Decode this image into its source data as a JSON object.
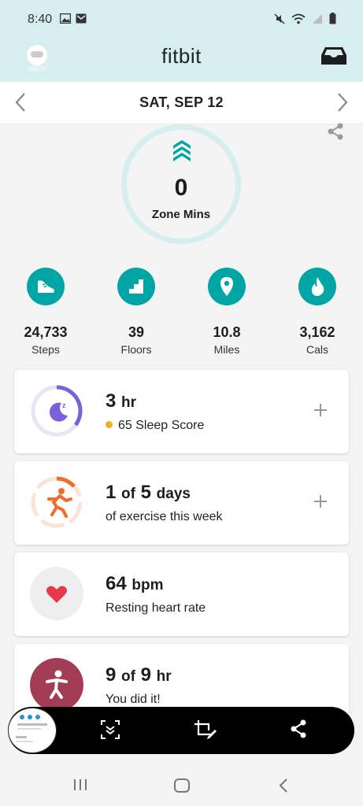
{
  "status": {
    "time": "8:40"
  },
  "header": {
    "title": "fitbit"
  },
  "date_nav": {
    "date": "SAT, SEP 12"
  },
  "zone": {
    "value": "0",
    "label": "Zone Mins"
  },
  "stats": [
    {
      "value": "24,733",
      "label": "Steps",
      "icon": "shoe-icon"
    },
    {
      "value": "39",
      "label": "Floors",
      "icon": "stairs-icon"
    },
    {
      "value": "10.8",
      "label": "Miles",
      "icon": "location-pin-icon"
    },
    {
      "value": "3,162",
      "label": "Cals",
      "icon": "flame-icon"
    }
  ],
  "cards": {
    "sleep": {
      "value": "3",
      "unit": "hr",
      "sub": "65 Sleep Score"
    },
    "exercise": {
      "value": "1",
      "of": "of",
      "total": "5",
      "unit": "days",
      "sub": "of exercise this week"
    },
    "heart": {
      "value": "64",
      "unit": "bpm",
      "sub": "Resting heart rate"
    },
    "hourly": {
      "value": "9",
      "of": "of",
      "total": "9",
      "unit": "hr",
      "sub": "You did it!"
    }
  },
  "colors": {
    "header_bg": "#d7eef0",
    "accent": "#00a5a5",
    "sleep": "#7b61d9",
    "exercise": "#f06c2b",
    "heart": "#e8394a",
    "hourly": "#a33d55"
  }
}
